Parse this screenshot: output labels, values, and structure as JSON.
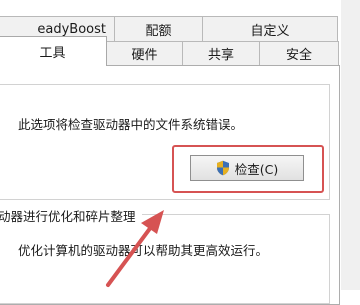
{
  "tabs_row1": [
    {
      "label": "eadyBoost"
    },
    {
      "label": "配额"
    },
    {
      "label": "自定义"
    }
  ],
  "tabs_row2": [
    {
      "label": "工具",
      "selected": true
    },
    {
      "label": "硬件"
    },
    {
      "label": "共享"
    },
    {
      "label": "安全"
    }
  ],
  "error_check": {
    "description": "此选项将检查驱动器中的文件系统错误。",
    "button_label": "检查(C)"
  },
  "optimize": {
    "title": "动器进行优化和碎片整理",
    "description": "优化计算机的驱动器可以帮助其更高效运行。"
  },
  "colors": {
    "annotation_red": "#d65353",
    "panel_border": "#adadad"
  }
}
